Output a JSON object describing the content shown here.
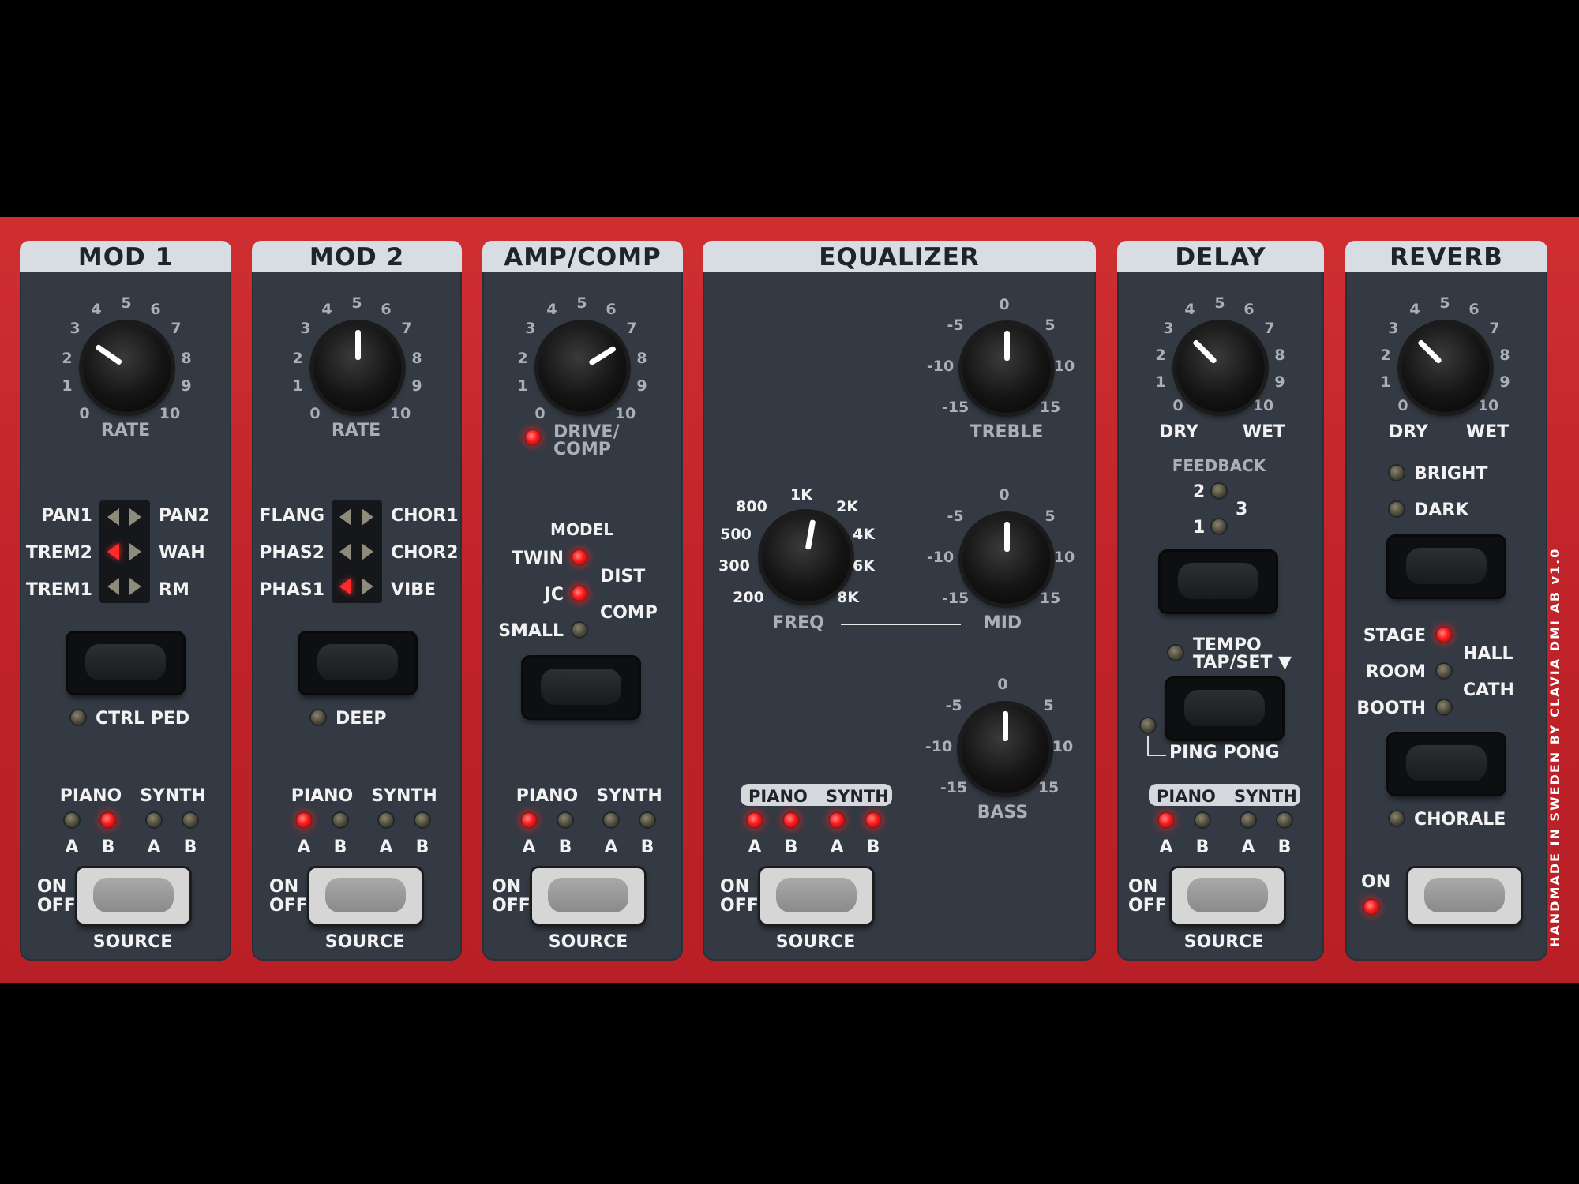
{
  "panels": {
    "mod1": {
      "title": "MOD 1",
      "knob": "RATE",
      "scale": [
        "0",
        "1",
        "2",
        "3",
        "4",
        "5",
        "6",
        "7",
        "8",
        "9",
        "10"
      ],
      "left": [
        "PAN1",
        "TREM2",
        "TREM1"
      ],
      "right": [
        "PAN2",
        "WAH",
        "RM"
      ],
      "led_label": "CTRL PED"
    },
    "mod2": {
      "title": "MOD 2",
      "knob": "RATE",
      "scale": [
        "0",
        "1",
        "2",
        "3",
        "4",
        "5",
        "6",
        "7",
        "8",
        "9",
        "10"
      ],
      "left": [
        "FLANG",
        "PHAS2",
        "PHAS1"
      ],
      "right": [
        "CHOR1",
        "CHOR2",
        "VIBE"
      ],
      "led_label": "DEEP"
    },
    "amp": {
      "title": "AMP/COMP",
      "scale": [
        "0",
        "1",
        "2",
        "3",
        "4",
        "5",
        "6",
        "7",
        "8",
        "9",
        "10"
      ],
      "drive": "DRIVE/",
      "comp": "COMP",
      "model": "MODEL",
      "twin": "TWIN",
      "jc": "JC",
      "small": "SMALL",
      "dist": "DIST",
      "comp2": "COMP"
    },
    "eq": {
      "title": "EQUALIZER",
      "treble": "TREBLE",
      "mid": "MID",
      "bass": "BASS",
      "freq": "FREQ",
      "gain": [
        "0",
        "-5",
        "5",
        "-10",
        "10",
        "-15",
        "15"
      ],
      "freqs": [
        "1K",
        "800",
        "2K",
        "500",
        "4K",
        "300",
        "6K",
        "200",
        "8K"
      ]
    },
    "delay": {
      "title": "DELAY",
      "dry": "DRY",
      "wet": "WET",
      "feedback": "FEEDBACK",
      "f1": "1",
      "f2": "2",
      "f3": "3",
      "tempo": "TEMPO",
      "tapset": "TAP/SET ▼",
      "pingpong": "PING PONG",
      "scale": [
        "0",
        "1",
        "2",
        "3",
        "4",
        "5",
        "6",
        "7",
        "8",
        "9",
        "10"
      ]
    },
    "reverb": {
      "title": "REVERB",
      "dry": "DRY",
      "wet": "WET",
      "bright": "BRIGHT",
      "dark": "DARK",
      "stage": "STAGE",
      "room": "ROOM",
      "booth": "BOOTH",
      "hall": "HALL",
      "cath": "CATH",
      "chorale": "CHORALE",
      "on": "ON",
      "scale": [
        "0",
        "1",
        "2",
        "3",
        "4",
        "5",
        "6",
        "7",
        "8",
        "9",
        "10"
      ]
    }
  },
  "common": {
    "piano": "PIANO",
    "synth": "SYNTH",
    "a": "A",
    "b": "B",
    "on": "ON",
    "off": "OFF",
    "source": "SOURCE"
  },
  "side_text": "HANDMADE IN SWEDEN BY CLAVIA DMI AB   v1.0"
}
